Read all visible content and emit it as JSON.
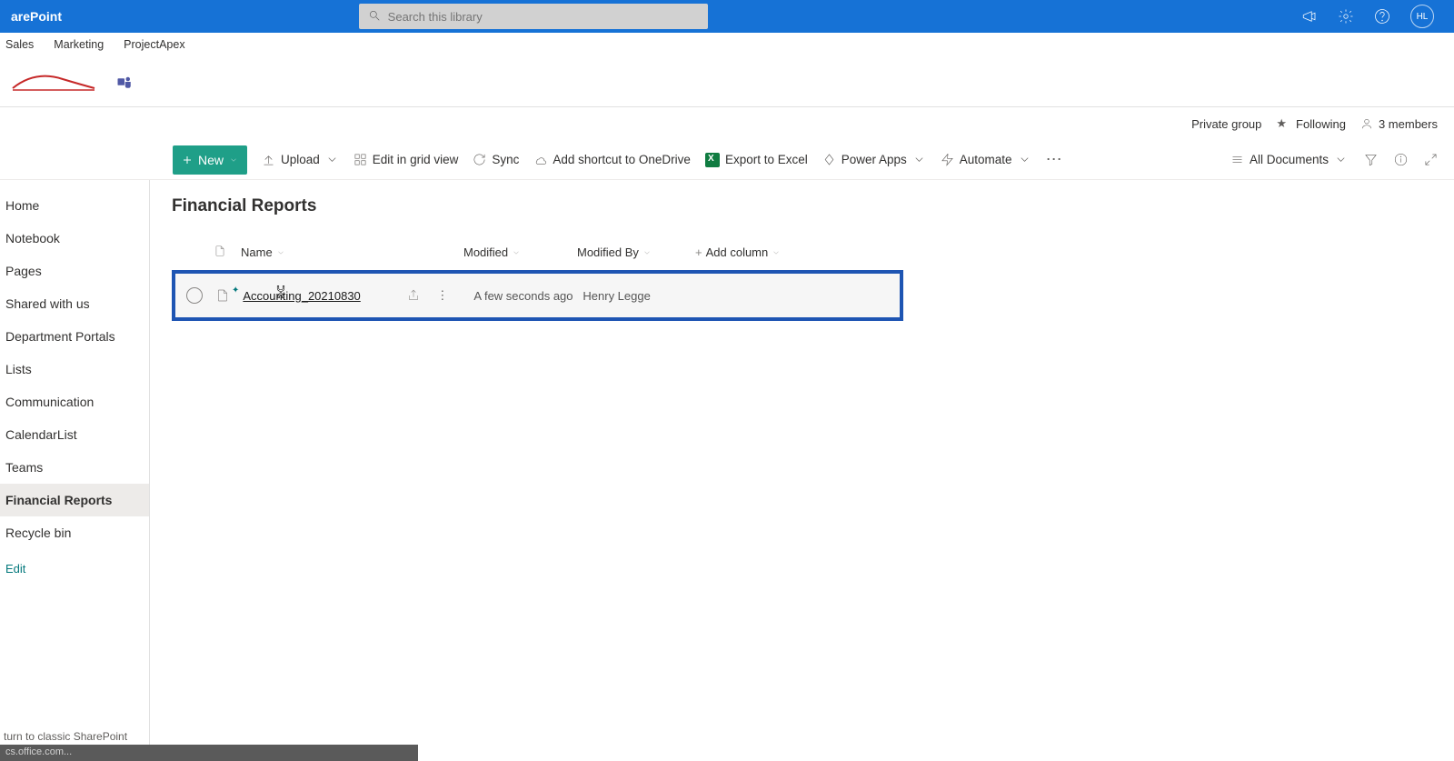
{
  "suite": {
    "app_name": "arePoint",
    "search_placeholder": "Search this library",
    "avatar_initials": "HL"
  },
  "nav_tabs": [
    "Sales",
    "Marketing",
    "ProjectApex"
  ],
  "info_bar": {
    "group_type": "Private group",
    "following_label": "Following",
    "members_label": "3 members"
  },
  "toolbar": {
    "new": "New",
    "upload": "Upload",
    "edit_grid": "Edit in grid view",
    "sync": "Sync",
    "shortcut": "Add shortcut to OneDrive",
    "export": "Export to Excel",
    "powerapps": "Power Apps",
    "automate": "Automate",
    "view": "All Documents"
  },
  "sidebar": {
    "items": [
      "Home",
      "Notebook",
      "Pages",
      "Shared with us",
      "Department Portals",
      "Lists",
      "Communication",
      "CalendarList",
      "Teams",
      "Financial Reports",
      "Recycle bin"
    ],
    "active_index": 9,
    "edit_label": "Edit"
  },
  "content": {
    "title": "Financial Reports",
    "columns": {
      "name": "Name",
      "modified": "Modified",
      "modified_by": "Modified By",
      "add": "Add column"
    },
    "rows": [
      {
        "name": "Accounting_20210830",
        "modified": "A few seconds ago",
        "modified_by": "Henry Legge"
      }
    ]
  },
  "footer": {
    "classic_link": "turn to classic SharePoint",
    "status_text": "cs.office.com..."
  }
}
